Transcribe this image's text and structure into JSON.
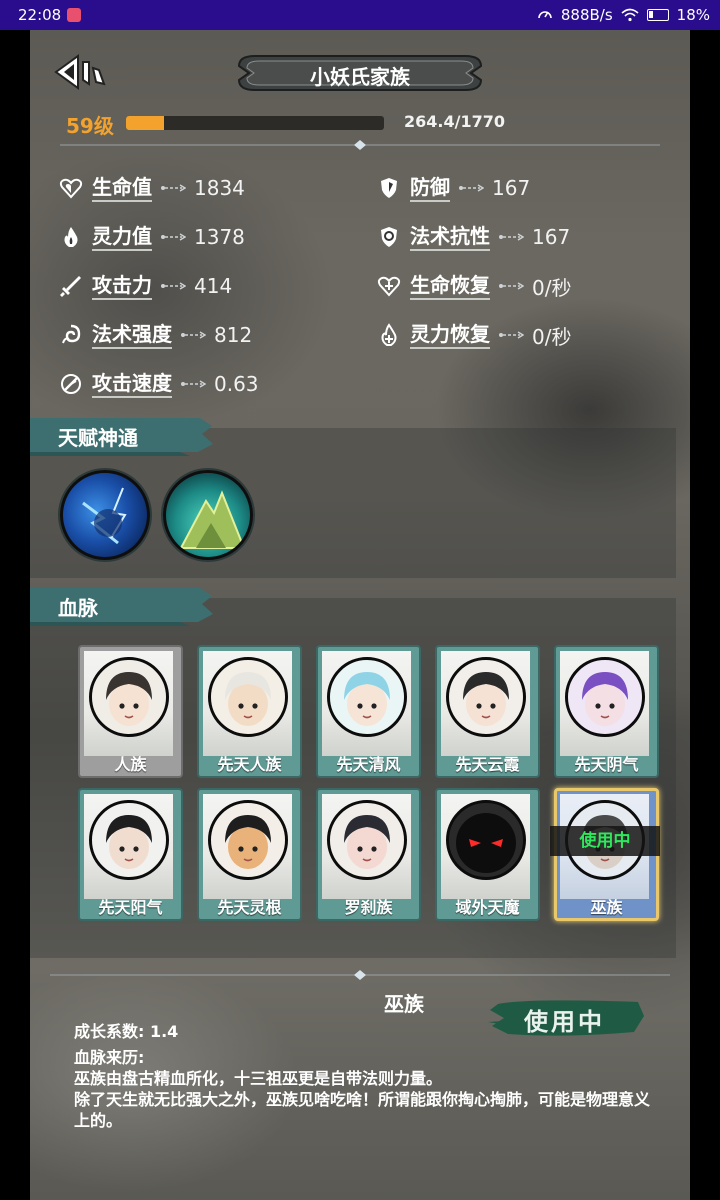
{
  "status_bar": {
    "time": "22:08",
    "network_speed": "888B/s",
    "battery": "18%"
  },
  "header": {
    "title": "小妖氏家族"
  },
  "level": {
    "label": "59级",
    "xp_text": "264.4/1770",
    "xp_fraction": 0.149
  },
  "stats": [
    {
      "key": "hp",
      "label": "生命值",
      "value": "1834",
      "icon": "heart-icon"
    },
    {
      "key": "defense",
      "label": "防御",
      "value": "167",
      "icon": "shield-icon"
    },
    {
      "key": "mana",
      "label": "灵力值",
      "value": "1378",
      "icon": "flame-icon"
    },
    {
      "key": "magic_resist",
      "label": "法术抗性",
      "value": "167",
      "icon": "magic-shield-icon"
    },
    {
      "key": "attack",
      "label": "攻击力",
      "value": "414",
      "icon": "sword-icon"
    },
    {
      "key": "hp_regen",
      "label": "生命恢复",
      "value": "0/秒",
      "icon": "heart-regen-icon"
    },
    {
      "key": "spell_power",
      "label": "法术强度",
      "value": "812",
      "icon": "spell-swirl-icon"
    },
    {
      "key": "mana_regen",
      "label": "灵力恢复",
      "value": "0/秒",
      "icon": "flame-regen-icon"
    },
    {
      "key": "attack_speed",
      "label": "攻击速度",
      "value": "0.63",
      "icon": "speed-icon"
    }
  ],
  "talents_section": {
    "title": "天赋神通",
    "items": [
      {
        "name": "lightning-talent-icon"
      },
      {
        "name": "mountain-talent-icon"
      }
    ]
  },
  "bloodline_section": {
    "title": "血脉",
    "cards": [
      {
        "name": "人族",
        "style": "gray"
      },
      {
        "name": "先天人族",
        "style": "normal"
      },
      {
        "name": "先天清风",
        "style": "normal"
      },
      {
        "name": "先天云霞",
        "style": "normal"
      },
      {
        "name": "先天阴气",
        "style": "normal"
      },
      {
        "name": "先天阳气",
        "style": "normal"
      },
      {
        "name": "先天灵根",
        "style": "normal"
      },
      {
        "name": "罗刹族",
        "style": "normal"
      },
      {
        "name": "域外天魔",
        "style": "normal"
      },
      {
        "name": "巫族",
        "style": "active"
      }
    ],
    "in_use_label": "使用中"
  },
  "detail": {
    "title": "巫族",
    "growth": "成长系数: 1.4",
    "origin_label": "血脉来历:",
    "origin_line1": "巫族由盘古精血所化，十三祖巫更是自带法则力量。",
    "origin_line2": "除了天生就无比强大之外，巫族见啥吃啥！所谓能跟你掏心掏肺，可能是物理意义上的。",
    "badge": "使用中"
  },
  "colors": {
    "accent_gold": "#f2a22d",
    "tab_teal": "#3d6f70",
    "card_teal": "#5f9a94",
    "in_use_green": "#2ee85c"
  }
}
